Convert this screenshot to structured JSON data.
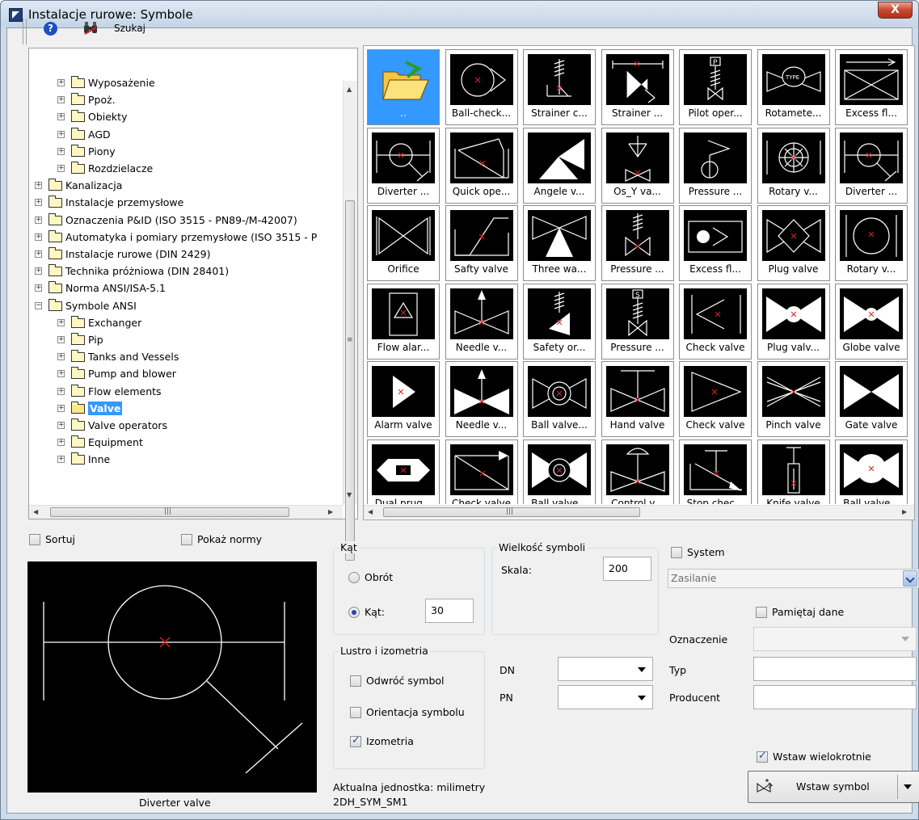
{
  "window": {
    "title": "Instalacje rurowe: Symbole",
    "close_label": "X"
  },
  "toolbar": {
    "search_label": "Szukaj"
  },
  "tree": [
    {
      "label": "Wyposażenie",
      "level": 2
    },
    {
      "label": "Ppoż.",
      "level": 2
    },
    {
      "label": "Obiekty",
      "level": 2
    },
    {
      "label": "AGD",
      "level": 2
    },
    {
      "label": "Piony",
      "level": 2
    },
    {
      "label": "Rozdzielacze",
      "level": 2
    },
    {
      "label": "Kanalizacja",
      "level": 1
    },
    {
      "label": "Instalacje przemysłowe",
      "level": 1
    },
    {
      "label": "Oznaczenia P&ID (ISO 3515 - PN89-/M-42007)",
      "level": 1
    },
    {
      "label": "Automatyka i pomiary przemysłowe (ISO 3515 - P",
      "level": 1
    },
    {
      "label": "Instalacje rurowe (DIN 2429)",
      "level": 1
    },
    {
      "label": "Technika próżniowa (DIN 28401)",
      "level": 1
    },
    {
      "label": "Norma ANSI/ISA-5.1",
      "level": 1
    },
    {
      "label": "Symbole ANSI",
      "level": 1,
      "expanded": true
    },
    {
      "label": "Exchanger",
      "level": 2
    },
    {
      "label": "Pip",
      "level": 2
    },
    {
      "label": "Tanks and Vessels",
      "level": 2
    },
    {
      "label": "Pump and blower",
      "level": 2
    },
    {
      "label": "Flow elements",
      "level": 2
    },
    {
      "label": "Valve",
      "level": 2,
      "selected": true
    },
    {
      "label": "Valve operators",
      "level": 2
    },
    {
      "label": "Equipment",
      "level": 2
    },
    {
      "label": "Inne",
      "level": 2
    }
  ],
  "symbols": [
    [
      {
        "cap": "..",
        "icon": "open-folder"
      },
      {
        "cap": "Ball-check...",
        "icon": "ball-check"
      },
      {
        "cap": "Strainer c...",
        "icon": "strainer-c"
      },
      {
        "cap": "Strainer ...",
        "icon": "strainer"
      },
      {
        "cap": "Pilot oper...",
        "icon": "pilot-operated"
      },
      {
        "cap": "Rotamete...",
        "icon": "rotameter"
      },
      {
        "cap": "Excess fl...",
        "icon": "excess-flow"
      }
    ],
    [
      {
        "cap": "Diverter ...",
        "icon": "diverter"
      },
      {
        "cap": "Quick ope...",
        "icon": "quick-opening"
      },
      {
        "cap": "Angele v...",
        "icon": "angle-valve"
      },
      {
        "cap": "Os_Y va...",
        "icon": "os-y-valve"
      },
      {
        "cap": "Pressure ...",
        "icon": "pressure-a"
      },
      {
        "cap": "Rotary v...",
        "icon": "rotary-a"
      },
      {
        "cap": "Diverter ...",
        "icon": "diverter-b"
      }
    ],
    [
      {
        "cap": "Orifice",
        "icon": "orifice"
      },
      {
        "cap": "Safty valve",
        "icon": "safety-valve"
      },
      {
        "cap": "Three wa...",
        "icon": "three-way"
      },
      {
        "cap": "Pressure ...",
        "icon": "pressure-b"
      },
      {
        "cap": "Excess fl...",
        "icon": "excess-flow-b"
      },
      {
        "cap": "Plug valve",
        "icon": "plug-valve"
      },
      {
        "cap": "Rotary v...",
        "icon": "rotary-b"
      }
    ],
    [
      {
        "cap": "Flow alar...",
        "icon": "flow-alarm"
      },
      {
        "cap": "Needle v...",
        "icon": "needle-a"
      },
      {
        "cap": "Safety or...",
        "icon": "safety-or"
      },
      {
        "cap": "Pressure ...",
        "icon": "pressure-c"
      },
      {
        "cap": "Check valve",
        "icon": "check-a"
      },
      {
        "cap": "Plug valv...",
        "icon": "plug-valve-b"
      },
      {
        "cap": "Globe valve",
        "icon": "globe-valve"
      }
    ],
    [
      {
        "cap": "Alarm valve",
        "icon": "alarm-valve"
      },
      {
        "cap": "Needle v...",
        "icon": "needle-b"
      },
      {
        "cap": "Ball valve...",
        "icon": "ball-valve-a"
      },
      {
        "cap": "Hand valve",
        "icon": "hand-valve"
      },
      {
        "cap": "Check valve",
        "icon": "check-b"
      },
      {
        "cap": "Pinch valve",
        "icon": "pinch-valve"
      },
      {
        "cap": "Gate valve",
        "icon": "gate-valve"
      }
    ],
    [
      {
        "cap": "Dual prug...",
        "icon": "dual-plug"
      },
      {
        "cap": "Check valve",
        "icon": "check-c"
      },
      {
        "cap": "Ball valve...",
        "icon": "ball-valve-b"
      },
      {
        "cap": "Control v...",
        "icon": "control-valve"
      },
      {
        "cap": "Stop chec...",
        "icon": "stop-check"
      },
      {
        "cap": "Knife valve",
        "icon": "knife-valve"
      },
      {
        "cap": "Ball valve...",
        "icon": "ball-valve-c"
      }
    ]
  ],
  "options": {
    "sort": "Sortuj",
    "show_norms": "Pokaż normy"
  },
  "preview": {
    "caption": "Diverter valve"
  },
  "angle": {
    "title": "Kąt",
    "rotation": "Obrót",
    "angle": "Kąt:",
    "value": "30"
  },
  "size": {
    "title": "Wielkość symboli",
    "scale_label": "Skala:",
    "scale_value": "200"
  },
  "mirror": {
    "title": "Lustro i izometria",
    "flip": "Odwróć symbol",
    "orientation": "Orientacja symbolu",
    "iso": "Izometria"
  },
  "system": {
    "label": "System",
    "value": "Zasilanie"
  },
  "remember": "Pamiętaj dane",
  "fields": {
    "dn": "DN",
    "pn": "PN",
    "oznaczenie": "Oznaczenie",
    "typ": "Typ",
    "producent": "Producent"
  },
  "multi_insert": "Wstaw wielokrotnie",
  "insert_button": "Wstaw symbol",
  "status": {
    "unit": "Aktualna jednostka: milimetry",
    "code": "2DH_SYM_SM1"
  },
  "colors": {
    "selection": "#3399ff",
    "symbol_bg": "#000000"
  }
}
